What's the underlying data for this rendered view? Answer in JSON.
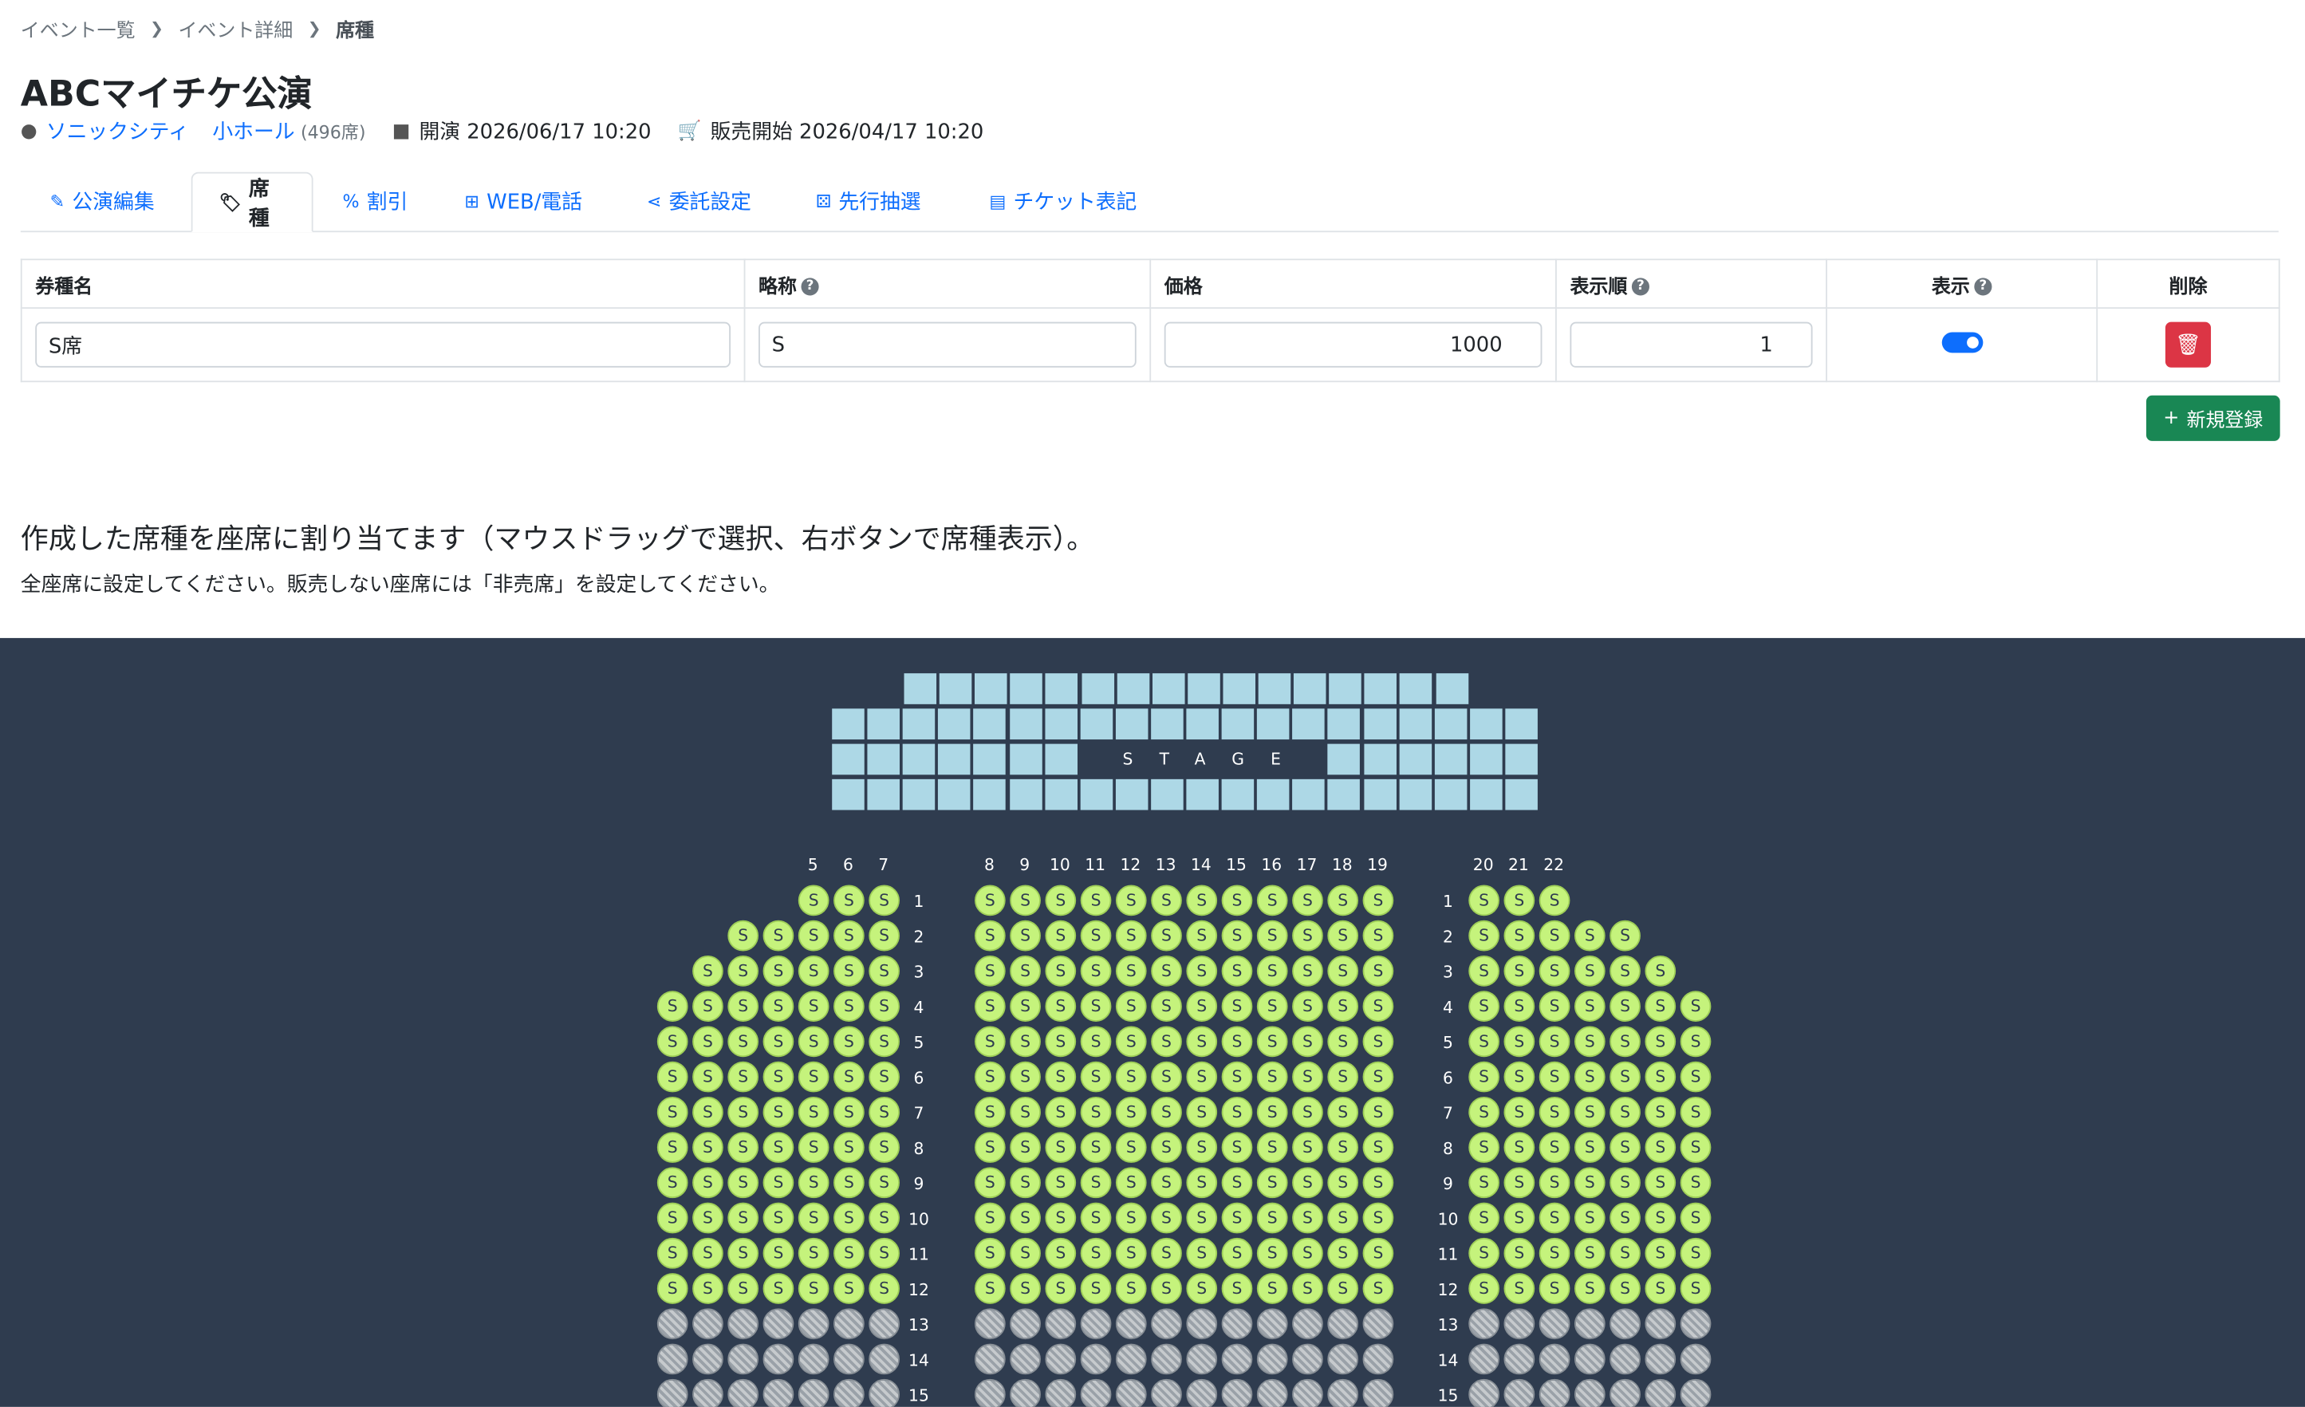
{
  "breadcrumb": [
    "イベント一覧",
    "イベント詳細",
    "席種"
  ],
  "title": "ABCマイチケ公演",
  "meta": {
    "venue": "ソニックシティ",
    "hall": "小ホール",
    "capacity": "(496席)",
    "performance": "開演 2026/06/17 10:20",
    "sale_start": "販売開始 2026/04/17 10:20"
  },
  "tabs": [
    {
      "label": "公演編集",
      "icon": "pencil-icon"
    },
    {
      "label": "席種",
      "icon": "tags-icon",
      "active": true
    },
    {
      "label": "割引",
      "icon": "percent-icon"
    },
    {
      "label": "WEB/電話",
      "icon": "sitemap-icon"
    },
    {
      "label": "委託設定",
      "icon": "share-icon"
    },
    {
      "label": "先行抽選",
      "icon": "dice-icon"
    },
    {
      "label": "チケット表記",
      "icon": "file-icon"
    }
  ],
  "table": {
    "headers": {
      "name": "券種名",
      "abbr": "略称",
      "price": "価格",
      "order": "表示順",
      "display": "表示",
      "delete": "削除"
    },
    "rows": [
      {
        "name": "S席",
        "abbr": "S",
        "price": "1000",
        "order": "1",
        "display": true
      }
    ]
  },
  "new_button": "新規登録",
  "instructions": {
    "line1": "作成した席種を座席に割り当てます（マウスドラッグで選択、右ボタンで席種表示）。",
    "line2": "全座席に設定してください。販売しない座席には「非売席」を設定してください。"
  },
  "seatmap": {
    "stage_label": "STAGE",
    "seat_label": "S",
    "rows": [
      "1",
      "2",
      "3",
      "4",
      "5",
      "6",
      "7",
      "8",
      "9",
      "10",
      "11",
      "12",
      "13",
      "14",
      "15"
    ],
    "left_cols": [
      "5",
      "6",
      "7"
    ],
    "center_cols": [
      "8",
      "9",
      "10",
      "11",
      "12",
      "13",
      "14",
      "15",
      "16",
      "17",
      "18",
      "19"
    ],
    "right_cols": [
      "20",
      "21",
      "22"
    ],
    "left_row_counts": [
      3,
      5,
      6,
      7,
      7,
      7,
      7,
      7,
      7,
      7,
      7,
      7,
      7,
      7,
      7
    ],
    "right_row_counts": [
      3,
      5,
      6,
      7,
      7,
      7,
      7,
      7,
      7,
      7,
      7,
      7,
      7,
      7,
      7
    ],
    "center_count": 12,
    "assigned_rows": 12,
    "colors": {
      "assigned": "#c5f37c",
      "background": "#2f3c4f",
      "stage": "#add8e6"
    }
  }
}
